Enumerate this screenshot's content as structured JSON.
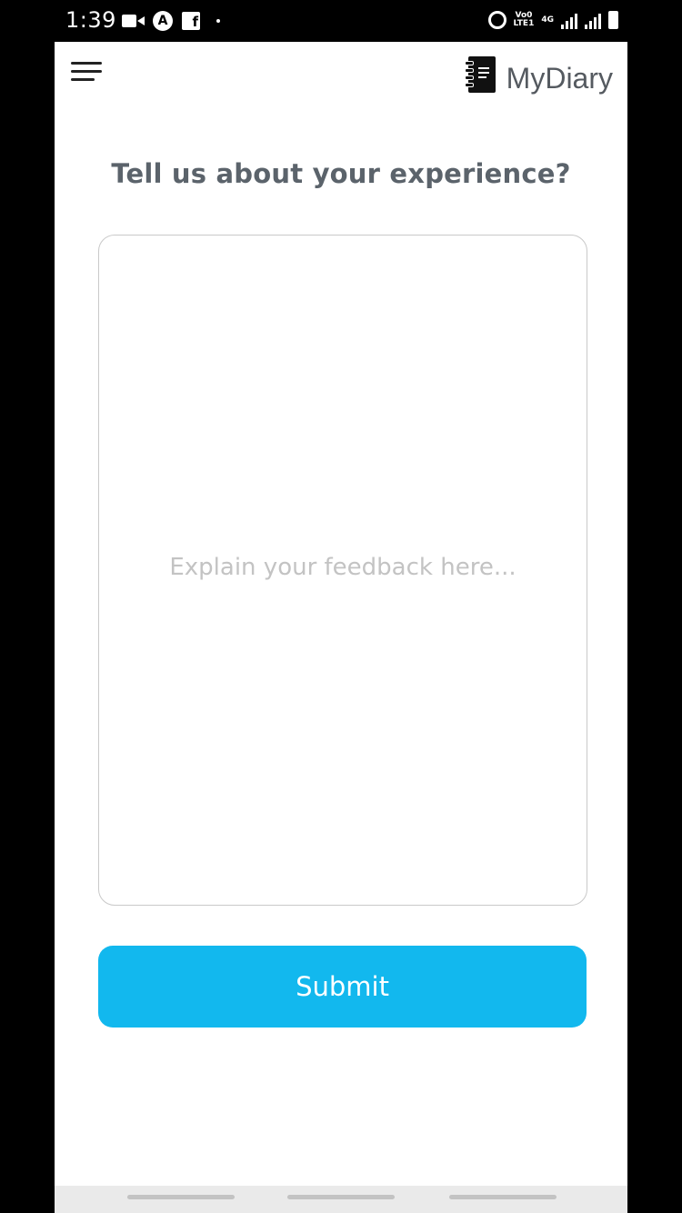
{
  "status_bar": {
    "time": "1:39",
    "network_top": "Vo0",
    "network_bottom": "LTE1",
    "network_type": "4G",
    "icons": [
      "video-icon",
      "a-circle-icon",
      "facebook-icon",
      "alarm-icon",
      "signal-icon",
      "battery-icon"
    ]
  },
  "header": {
    "menu_icon": "hamburger-menu-icon",
    "logo_icon": "notebook-icon",
    "brand_name": "MyDiary"
  },
  "feedback": {
    "question": "Tell us about your experience?",
    "placeholder": "Explain your feedback here...",
    "value": ""
  },
  "actions": {
    "submit_label": "Submit"
  },
  "colors": {
    "accent": "#12b8ee",
    "heading": "#5b636b",
    "placeholder": "#c3c3c3"
  }
}
